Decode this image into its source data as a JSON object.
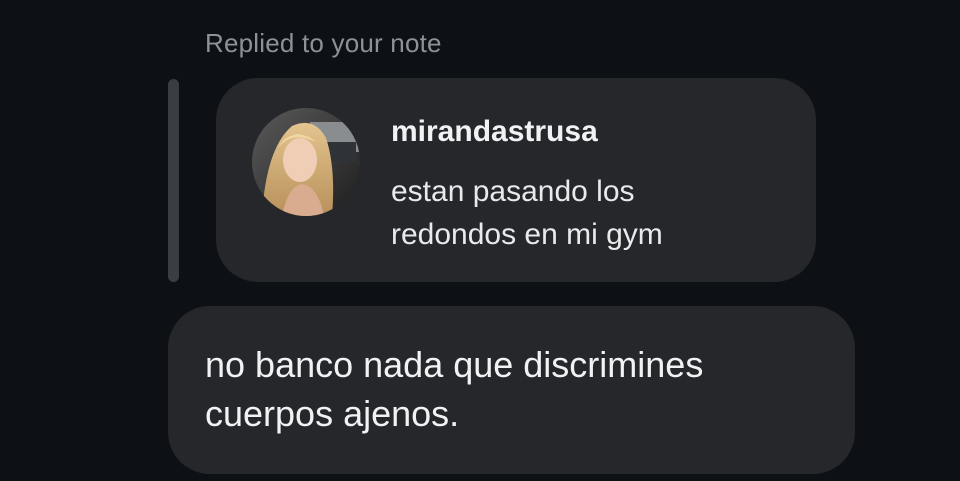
{
  "reply": {
    "label": "Replied to your note"
  },
  "note": {
    "username": "mirandastrusa",
    "text_lines": [
      "estan pasando los",
      "redondos en mi gym"
    ],
    "avatar": "profile-photo"
  },
  "message": {
    "text_lines": [
      "no banco nada que discrimines",
      "cuerpos ajenos."
    ]
  },
  "colors": {
    "background": "#0d1116",
    "bubble": "#25272b",
    "label": "#8e9297",
    "text": "#f1f2f4"
  }
}
